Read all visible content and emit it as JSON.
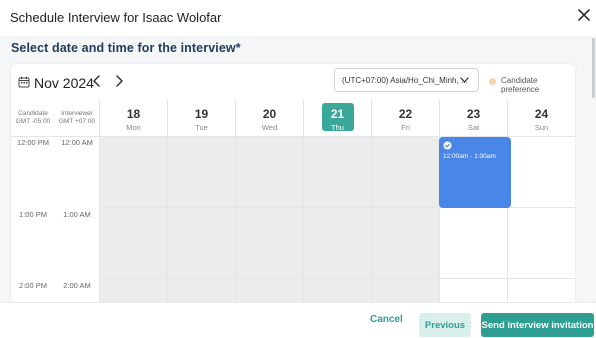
{
  "dialog": {
    "title": "Schedule Interview for Isaac Wolofar",
    "subtitle": "Select date and time for the interview*"
  },
  "calendar": {
    "month_label": "Nov 2024",
    "timezone_select": "(UTC+07:00) Asia/Ho_Chi_Minh, ...",
    "legend_label": "Candidate preference",
    "candidate_col": {
      "line1": "Candidate",
      "line2": "GMT -05:00"
    },
    "interviewer_col": {
      "line1": "Interviewer",
      "line2": "GMT +07:00"
    },
    "days": [
      {
        "num": "18",
        "name": "Mon"
      },
      {
        "num": "19",
        "name": "Tue"
      },
      {
        "num": "20",
        "name": "Wed"
      },
      {
        "num": "21",
        "name": "Thu"
      },
      {
        "num": "22",
        "name": "Fri"
      },
      {
        "num": "23",
        "name": "Sat"
      },
      {
        "num": "24",
        "name": "Sun"
      }
    ],
    "candidate_times": [
      "12:00 PM",
      "1:00 PM",
      "2:00 PM"
    ],
    "interviewer_times": [
      "12:00 AM",
      "1:00 AM",
      "2:00 AM"
    ],
    "event": {
      "label": "12:00am - 1:00am",
      "day": "23"
    }
  },
  "footer": {
    "cancel_label": "Cancel",
    "previous_label": "Previous",
    "send_label": "Send interview invitation"
  },
  "colors": {
    "accent": "#2e9e92",
    "today_highlight": "#3aa79a",
    "event": "#4a86e8",
    "candidate_pref_dot": "#f5d3a6"
  },
  "icons": [
    "calendar-icon",
    "chevron-left-icon",
    "chevron-right-icon",
    "chevron-down-icon",
    "close-icon",
    "check-circle-icon"
  ]
}
